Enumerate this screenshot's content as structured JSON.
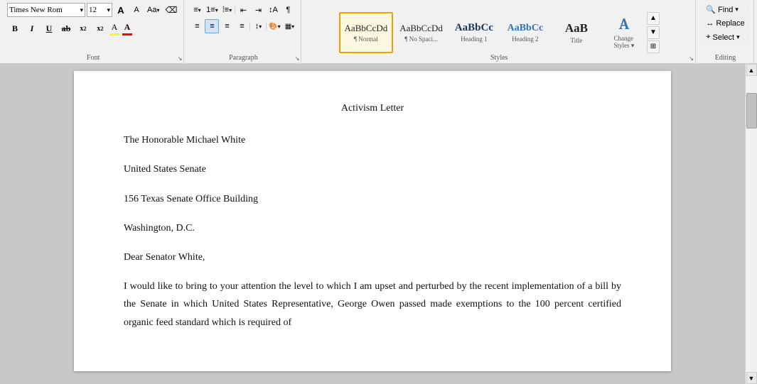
{
  "ribbon": {
    "font": {
      "name": "Times New Rom",
      "size": "12",
      "label": "Font"
    },
    "paragraph": {
      "label": "Paragraph"
    },
    "styles": {
      "label": "Styles",
      "items": [
        {
          "id": "normal",
          "preview": "AaBbCcDd",
          "sub": "¶ Normal",
          "active": true
        },
        {
          "id": "no-spacing",
          "preview": "AaBbCcDd",
          "sub": "¶ No Spaci...",
          "active": false
        },
        {
          "id": "heading1",
          "preview": "AaBbCc",
          "sub": "Heading 1",
          "active": false
        },
        {
          "id": "heading2",
          "preview": "AaBbCc",
          "sub": "Heading 2",
          "active": false
        },
        {
          "id": "title",
          "preview": "AaB",
          "sub": "Title",
          "active": false
        },
        {
          "id": "change",
          "preview": "A",
          "sub": "Change\nStyles -",
          "active": false
        }
      ]
    },
    "editing": {
      "label": "Editing",
      "find": "Find",
      "replace": "Replace",
      "select": "Select"
    }
  },
  "document": {
    "title": "Activism Letter",
    "paragraphs": [
      "The Honorable Michael White",
      "United States Senate",
      "156 Texas Senate Office Building",
      "Washington, D.C.",
      "Dear Senator White,",
      "I would like to bring to your attention the level to which I am upset and perturbed by the recent\nimplementation of a bill by the Senate in which United States Representative, George Owen\npassed made exemptions to the 100 percent certified organic feed standard which is required of"
    ]
  }
}
